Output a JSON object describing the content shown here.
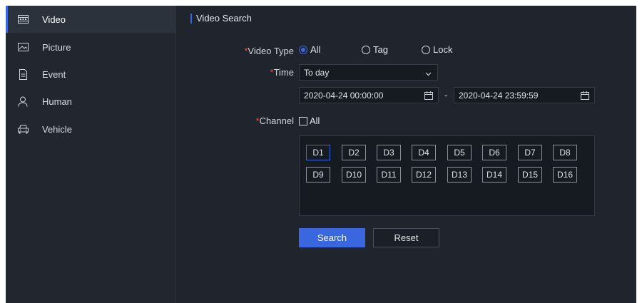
{
  "sidebar": {
    "items": [
      {
        "label": "Video",
        "icon": "video-icon"
      },
      {
        "label": "Picture",
        "icon": "picture-icon"
      },
      {
        "label": "Event",
        "icon": "event-icon"
      },
      {
        "label": "Human",
        "icon": "human-icon"
      },
      {
        "label": "Vehicle",
        "icon": "vehicle-icon"
      }
    ],
    "active_index": 0
  },
  "main": {
    "title": "Video Search",
    "video_type": {
      "label": "Video Type",
      "options": [
        "All",
        "Tag",
        "Lock"
      ],
      "selected": "All"
    },
    "time": {
      "label": "Time",
      "value": "To day",
      "start": "2020-04-24 00:00:00",
      "separator": "-",
      "end": "2020-04-24 23:59:59"
    },
    "channel": {
      "label": "Channel",
      "all_label": "All",
      "all_checked": false,
      "channels": [
        "D1",
        "D2",
        "D3",
        "D4",
        "D5",
        "D6",
        "D7",
        "D8",
        "D9",
        "D10",
        "D11",
        "D12",
        "D13",
        "D14",
        "D15",
        "D16"
      ],
      "selected": [
        "D1"
      ]
    },
    "buttons": {
      "search": "Search",
      "reset": "Reset"
    }
  },
  "colors": {
    "accent": "#3a66e0",
    "background": "#1f242d",
    "required": "#e04848"
  }
}
